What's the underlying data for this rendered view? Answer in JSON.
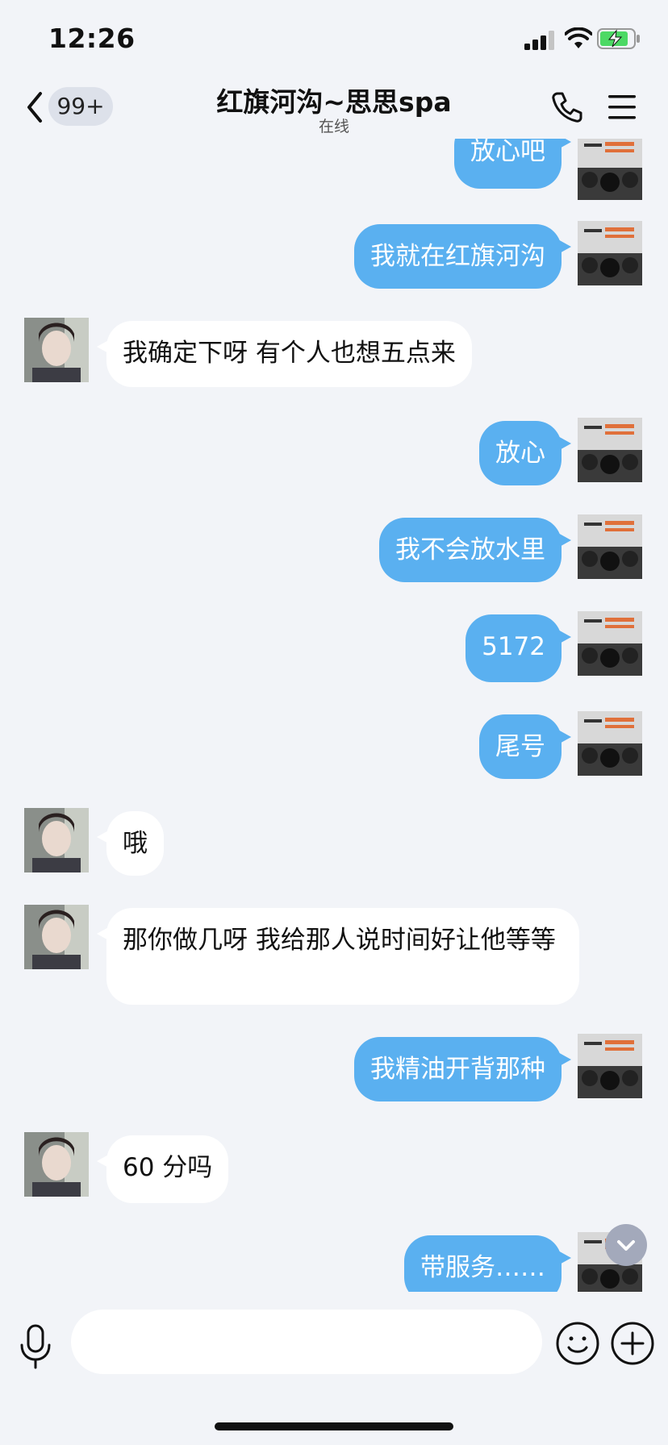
{
  "status_bar": {
    "time": "12:26",
    "signal_icon": "cellular-signal-icon",
    "wifi_icon": "wifi-icon",
    "battery_icon": "battery-charging-icon"
  },
  "header": {
    "unread_badge": "99+",
    "title": "红旗河沟~思思spa",
    "subtitle": "在线",
    "back_icon": "chevron-left-icon",
    "call_icon": "phone-icon",
    "menu_icon": "menu-icon"
  },
  "messages": [
    {
      "sender": "self",
      "text": "放心吧"
    },
    {
      "sender": "self",
      "text": "我就在红旗河沟"
    },
    {
      "sender": "peer",
      "text": "我确定下呀  有个人也想五点来"
    },
    {
      "sender": "self",
      "text": "放心"
    },
    {
      "sender": "self",
      "text": "我不会放水里"
    },
    {
      "sender": "self",
      "text": "5172"
    },
    {
      "sender": "self",
      "text": "尾号"
    },
    {
      "sender": "peer",
      "text": "哦"
    },
    {
      "sender": "peer",
      "text": " 那你做几呀  我给那人说时间好让他等等"
    },
    {
      "sender": "self",
      "text": "我精油开背那种"
    },
    {
      "sender": "peer",
      "text": "60 分吗"
    },
    {
      "sender": "self",
      "text": "带服务……"
    }
  ],
  "composer": {
    "input_value": "",
    "mic_icon": "microphone-icon",
    "emoji_icon": "emoji-icon",
    "plus_icon": "plus-icon"
  },
  "scroll_down_icon": "chevron-down-icon",
  "colors": {
    "background": "#f2f4f8",
    "self_bubble": "#5ab0f0",
    "peer_bubble": "#ffffff",
    "unread_badge_bg": "#dde1ea"
  }
}
